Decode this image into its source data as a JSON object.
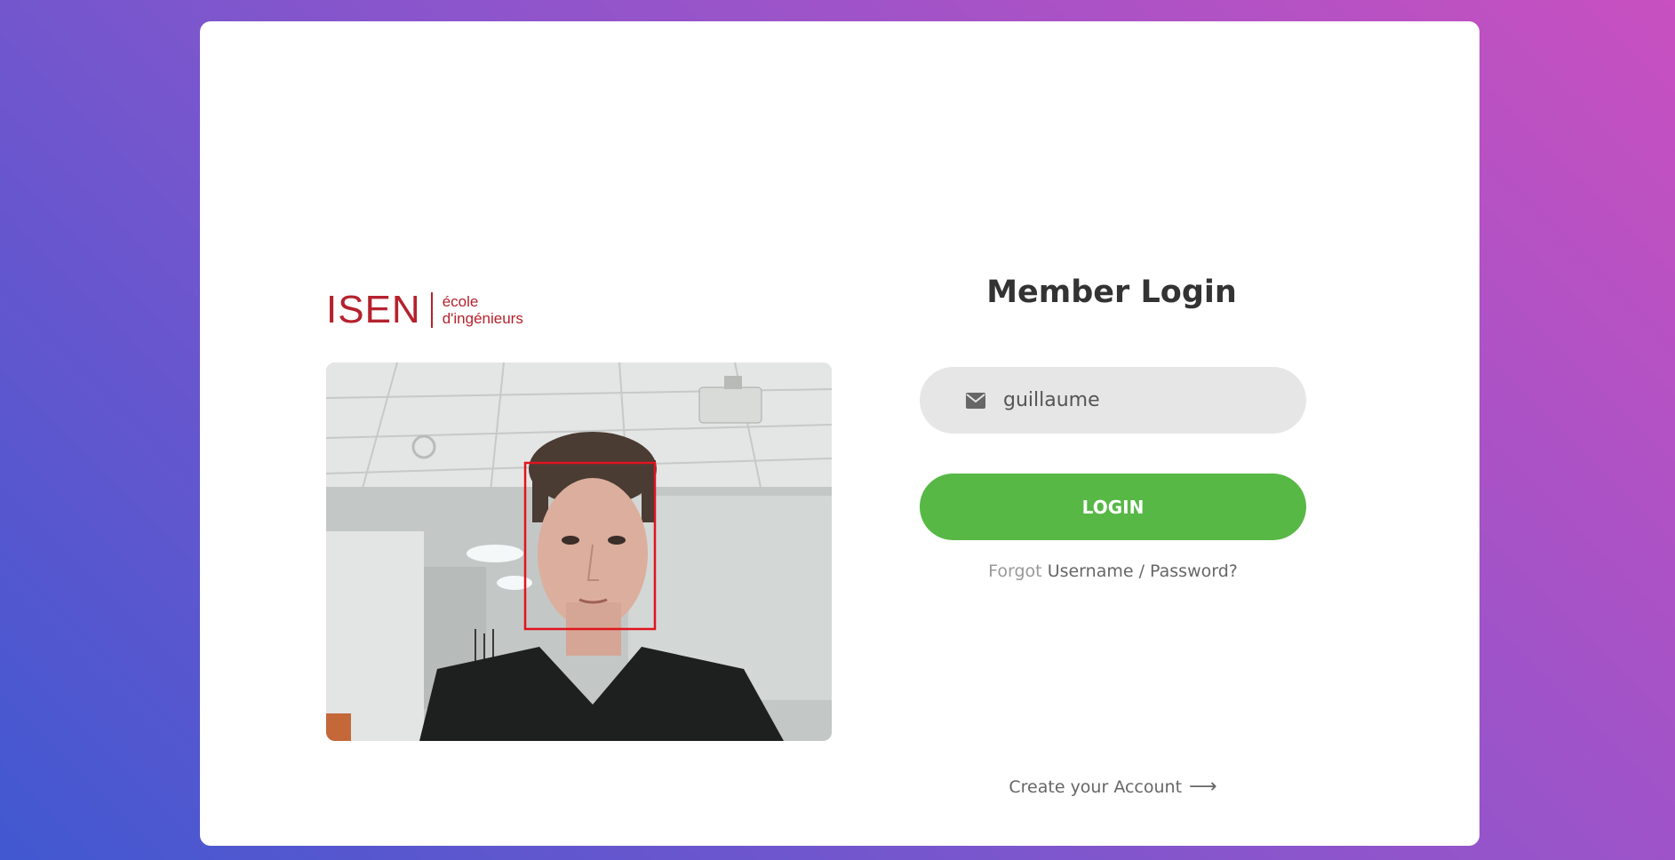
{
  "logo": {
    "main": "ISEN",
    "sub_line1": "école",
    "sub_line2": "d'ingénieurs",
    "color": "#b5222d"
  },
  "camera": {
    "icon": "webcam-feed-image",
    "face_box_color": "#e0141e"
  },
  "login": {
    "title": "Member Login",
    "username_value": "guillaume",
    "username_icon": "envelope-icon",
    "button_label": "LOGIN",
    "forgot_prefix": "Forgot",
    "forgot_link": "Username / Password?",
    "create_account": "Create your Account",
    "create_icon": "arrow-right-icon"
  },
  "colors": {
    "accent_green": "#57b846",
    "gradient_start": "#4158d0",
    "gradient_end": "#c850c0"
  }
}
